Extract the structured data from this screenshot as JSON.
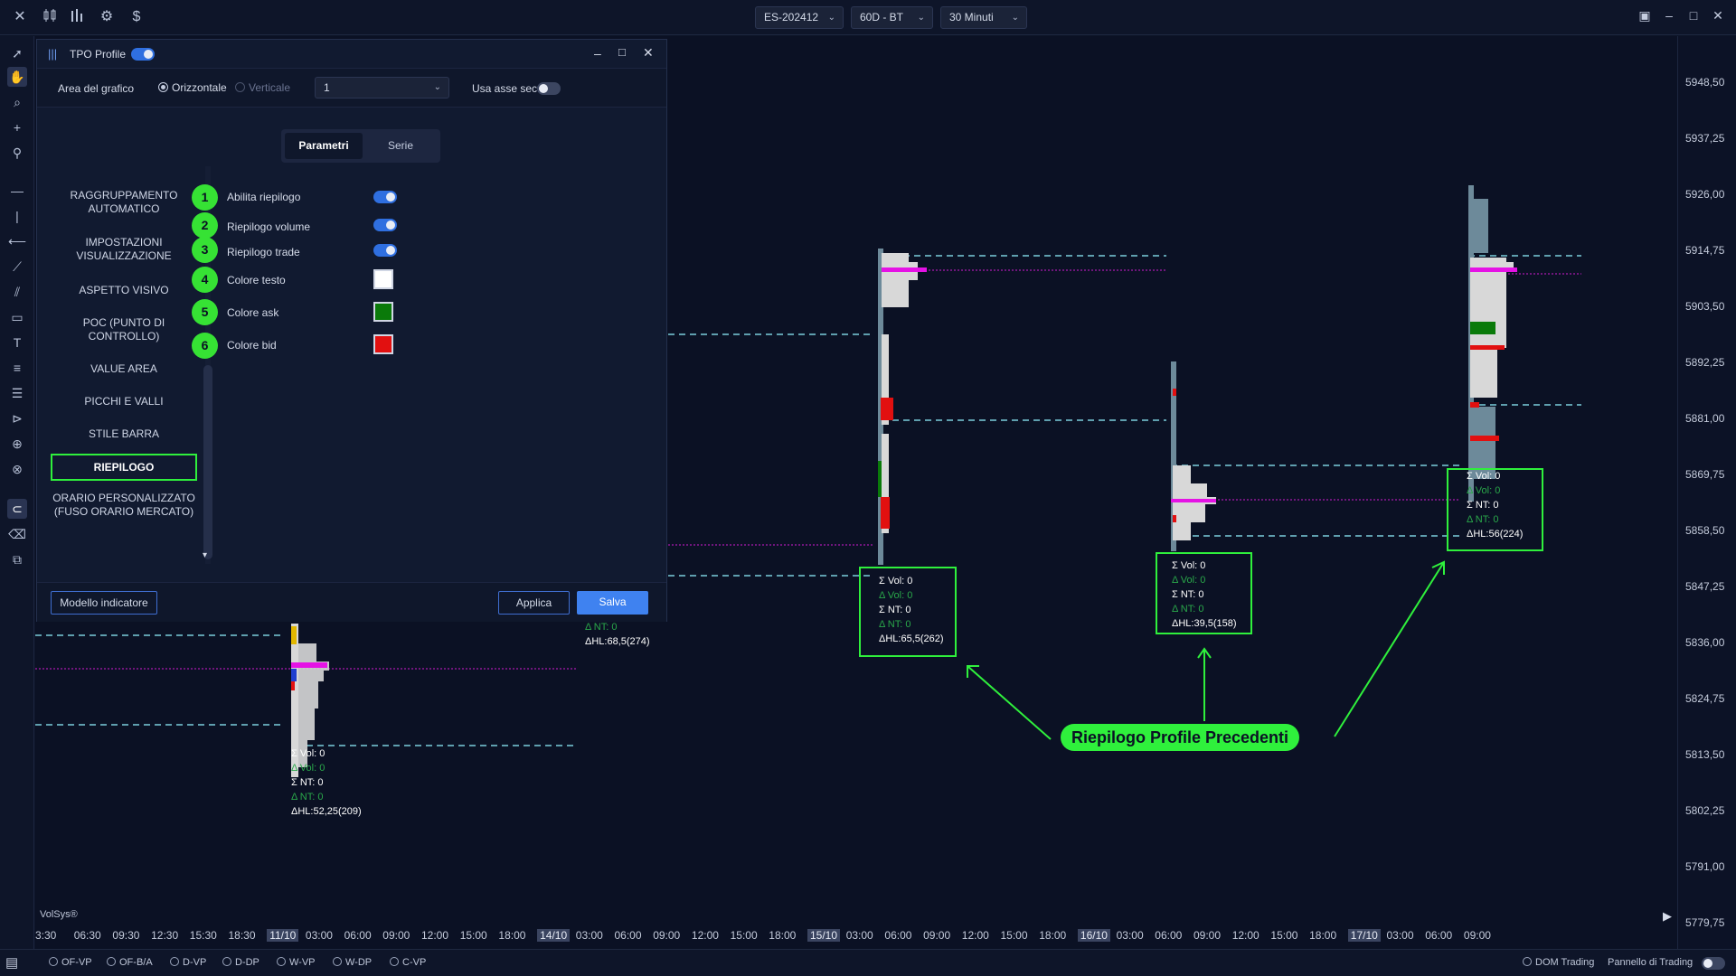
{
  "topbar": {
    "symbol": "ES-202412",
    "period": "60D - BT",
    "timeframe": "30 Minuti"
  },
  "dialog": {
    "title": "TPO Profile",
    "area_label": "Area del grafico",
    "radio_horizontal": "Orizzontale",
    "radio_vertical": "Verticale",
    "area_value": "1",
    "secondary_axis_label": "Usa asse sec.",
    "tabs": [
      "Parametri",
      "Serie"
    ],
    "menu": [
      "RAGGRUPPAMENTO AUTOMATICO",
      "IMPOSTAZIONI VISUALIZZAZIONE",
      "ASPETTO VISIVO",
      "POC (PUNTO DI CONTROLLO)",
      "VALUE AREA",
      "PICCHI E VALLI",
      "STILE BARRA",
      "RIEPILOGO",
      "ORARIO PERSONALIZZATO (FUSO ORARIO MERCATO)"
    ],
    "params": [
      {
        "num": "1",
        "label": "Abilita riepilogo",
        "type": "toggle",
        "on": true
      },
      {
        "num": "2",
        "label": "Riepilogo volume",
        "type": "toggle",
        "on": true
      },
      {
        "num": "3",
        "label": "Riepilogo trade",
        "type": "toggle",
        "on": true
      },
      {
        "num": "4",
        "label": "Colore testo",
        "type": "color",
        "color": "#ffffff"
      },
      {
        "num": "5",
        "label": "Colore ask",
        "type": "color",
        "color": "#0a7a0a"
      },
      {
        "num": "6",
        "label": "Colore bid",
        "type": "color",
        "color": "#e21010"
      }
    ],
    "template_button": "Modello indicatore",
    "apply_button": "Applica",
    "save_button": "Salva"
  },
  "summaries": [
    {
      "vol": "Σ Vol: 0",
      "dvol": "Δ Vol: 0",
      "nt": "Σ NT: 0",
      "dnt": "Δ NT: 0",
      "hl": "ΔHL:52,25(209)"
    },
    {
      "vol": "Σ Vol: 0",
      "dvol": "Δ Vol: 0",
      "nt": "Σ NT: 0",
      "dnt": "Δ NT: 0",
      "hl": "ΔHL:65,5(262)"
    },
    {
      "vol": "Σ Vol: 0",
      "dvol": "Δ Vol: 0",
      "nt": "Σ NT: 0",
      "dnt": "Δ NT: 0",
      "hl": "ΔHL:39,5(158)"
    },
    {
      "vol": "Σ Vol: 0",
      "dvol": "Δ Vol: 0",
      "nt": "Σ NT: 0",
      "dnt": "Δ NT: 0",
      "hl": "ΔHL:56(224)"
    }
  ],
  "partial_summary": {
    "dnt": "Δ NT: 0",
    "hl": "ΔHL:68,5(274)"
  },
  "callout": "Riepilogo Profile Precedenti",
  "watermark": "VolSys®",
  "y_axis": [
    "5948,50",
    "5937,25",
    "5926,00",
    "5914,75",
    "5903,50",
    "5892,25",
    "5881,00",
    "5869,75",
    "5858,50",
    "5847,25",
    "5836,00",
    "5824,75",
    "5813,50",
    "5802,25",
    "5791,00",
    "5779,75"
  ],
  "x_axis": [
    {
      "t": "3:30"
    },
    {
      "t": "06:30"
    },
    {
      "t": "09:30"
    },
    {
      "t": "12:30"
    },
    {
      "t": "15:30"
    },
    {
      "t": "18:30"
    },
    {
      "t": "11/10",
      "day": true
    },
    {
      "t": "03:00"
    },
    {
      "t": "06:00"
    },
    {
      "t": "09:00"
    },
    {
      "t": "12:00"
    },
    {
      "t": "15:00"
    },
    {
      "t": "18:00"
    },
    {
      "t": "14/10",
      "day": true
    },
    {
      "t": "03:00"
    },
    {
      "t": "06:00"
    },
    {
      "t": "09:00"
    },
    {
      "t": "12:00"
    },
    {
      "t": "15:00"
    },
    {
      "t": "18:00"
    },
    {
      "t": "15/10",
      "day": true
    },
    {
      "t": "03:00"
    },
    {
      "t": "06:00"
    },
    {
      "t": "09:00"
    },
    {
      "t": "12:00"
    },
    {
      "t": "15:00"
    },
    {
      "t": "18:00"
    },
    {
      "t": "16/10",
      "day": true
    },
    {
      "t": "03:00"
    },
    {
      "t": "06:00"
    },
    {
      "t": "09:00"
    },
    {
      "t": "12:00"
    },
    {
      "t": "15:00"
    },
    {
      "t": "18:00"
    },
    {
      "t": "17/10",
      "day": true
    },
    {
      "t": "03:00"
    },
    {
      "t": "06:00"
    },
    {
      "t": "09:00"
    }
  ],
  "bottombar": {
    "radios": [
      "OF-VP",
      "OF-B/A",
      "D-VP",
      "D-DP",
      "W-VP",
      "W-DP",
      "C-VP"
    ],
    "dom_trading": "DOM Trading",
    "panel_trading": "Pannello di Trading"
  }
}
